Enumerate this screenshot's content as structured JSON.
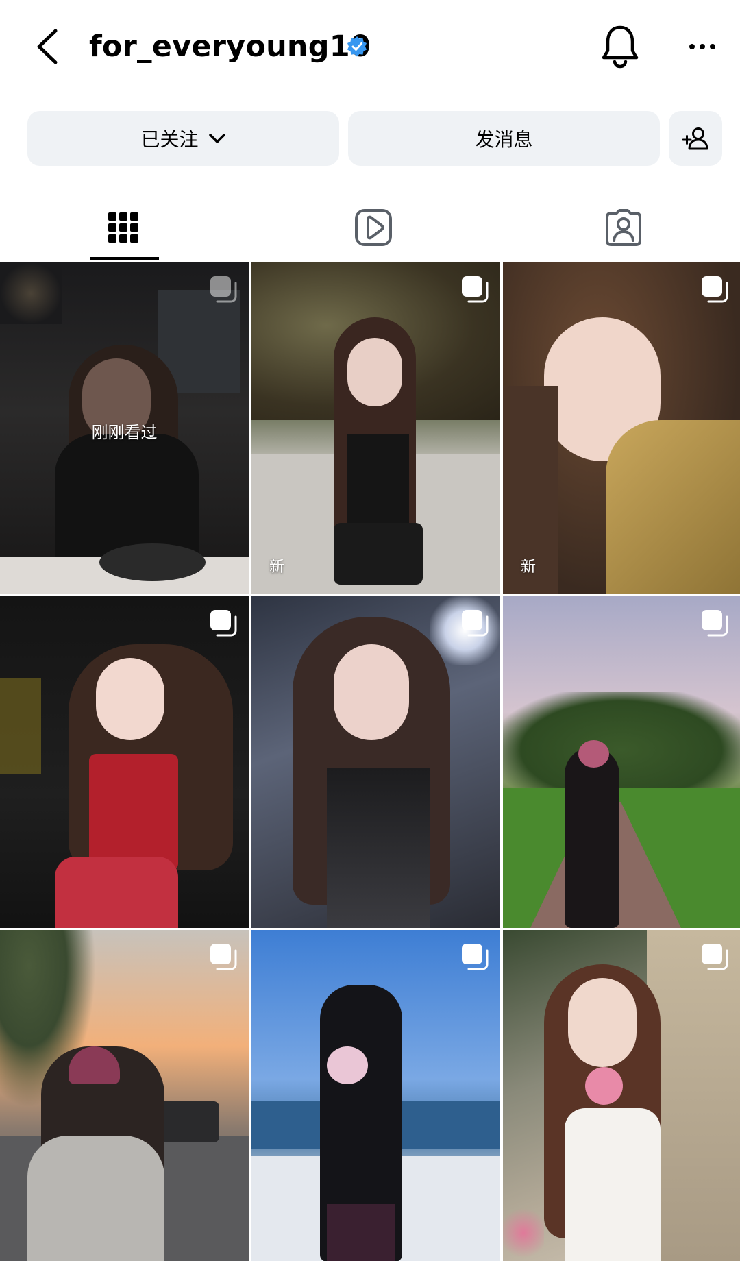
{
  "header": {
    "username": "for_everyoung10",
    "back_icon": "chevron-left-icon",
    "verified_icon": "verified-badge-icon",
    "notification_icon": "bell-icon",
    "more_icon": "ellipsis-icon",
    "verified_color": "#3797f0"
  },
  "actions": {
    "following_label": "已关注",
    "message_label": "发消息",
    "add_friend_icon": "add-person-icon"
  },
  "tabs": [
    {
      "name": "posts",
      "icon": "grid-icon",
      "active": true
    },
    {
      "name": "reels",
      "icon": "reels-icon",
      "active": false
    },
    {
      "name": "tagged",
      "icon": "tagged-person-icon",
      "active": false
    }
  ],
  "posts": [
    {
      "overlay_text": "刚刚看过",
      "new_label": "",
      "multi": true
    },
    {
      "overlay_text": "",
      "new_label": "新",
      "multi": true
    },
    {
      "overlay_text": "",
      "new_label": "新",
      "multi": true
    },
    {
      "overlay_text": "",
      "new_label": "",
      "multi": true
    },
    {
      "overlay_text": "",
      "new_label": "",
      "multi": true
    },
    {
      "overlay_text": "",
      "new_label": "",
      "multi": true
    },
    {
      "overlay_text": "",
      "new_label": "",
      "multi": true
    },
    {
      "overlay_text": "",
      "new_label": "",
      "multi": true
    },
    {
      "overlay_text": "",
      "new_label": "",
      "multi": true
    }
  ],
  "colors": {
    "button_bg": "#eff2f5",
    "active_tab": "#000000",
    "inactive_icon": "#5a6068"
  }
}
